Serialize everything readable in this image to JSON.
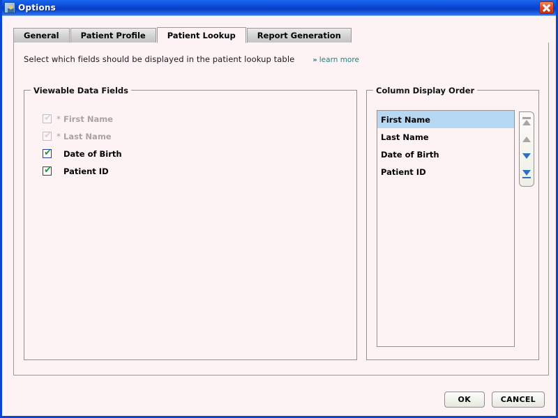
{
  "window": {
    "title": "Options",
    "app_icon": "person-options-icon",
    "close_label": "close-icon",
    "frame_color": "#0a46d2",
    "background_color": "#fdf3f5"
  },
  "tabs": [
    {
      "label": "General",
      "active": false
    },
    {
      "label": "Patient Profile",
      "active": false
    },
    {
      "label": "Patient Lookup",
      "active": true
    },
    {
      "label": "Report Generation",
      "active": false
    }
  ],
  "instruction": {
    "text": "Select which fields should be displayed in the patient lookup table",
    "link_chevrons": "»",
    "link_label": "learn more",
    "link_color": "#1f7f87"
  },
  "viewable_fields": {
    "legend": "Viewable Data Fields",
    "items": [
      {
        "label": "First Name",
        "checked": true,
        "enabled": false,
        "required_marker": "*"
      },
      {
        "label": "Last Name",
        "checked": true,
        "enabled": false,
        "required_marker": "*"
      },
      {
        "label": "Date of Birth",
        "checked": true,
        "enabled": true,
        "required_marker": ""
      },
      {
        "label": "Patient ID",
        "checked": true,
        "enabled": true,
        "required_marker": ""
      }
    ],
    "check_glyph": "✔"
  },
  "column_order": {
    "legend": "Column Display Order",
    "items": [
      {
        "label": "First Name",
        "selected": true
      },
      {
        "label": "Last Name",
        "selected": false
      },
      {
        "label": "Date of Birth",
        "selected": false
      },
      {
        "label": "Patient ID",
        "selected": false
      }
    ],
    "selection_color": "#b7d8f2",
    "buttons": [
      {
        "name": "move-to-top-button",
        "enabled": false
      },
      {
        "name": "move-up-button",
        "enabled": false
      },
      {
        "name": "move-down-button",
        "enabled": true
      },
      {
        "name": "move-to-bottom-button",
        "enabled": true
      }
    ]
  },
  "footer": {
    "ok_label": "OK",
    "cancel_label": "CANCEL"
  }
}
